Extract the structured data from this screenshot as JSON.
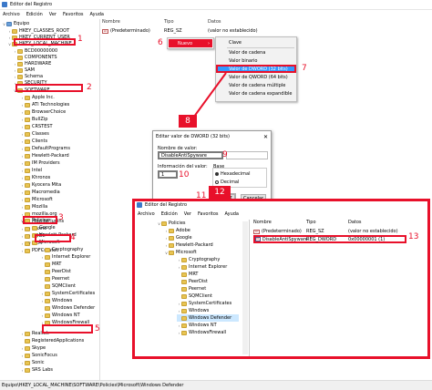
{
  "window": {
    "title": "Editor del Registro"
  },
  "menu": [
    "Archivo",
    "Edición",
    "Ver",
    "Favoritos",
    "Ayuda"
  ],
  "tree": {
    "root": "Equipo",
    "items": [
      "HKEY_CLASSES_ROOT",
      "HKEY_CURRENT_USER",
      "HKEY_LOCAL_MACHINE",
      "BCD00000000",
      "COMPONENTS",
      "HARDWARE",
      "SAM",
      "Schema",
      "SECURITY",
      "SOFTWARE",
      "Apple Inc.",
      "ATI Technologies",
      "BrowserChoice",
      "BullZip",
      "CRSTEST",
      "Classes",
      "Clients",
      "DefaultPrograms",
      "Hewlett-Packard",
      "IM Providers",
      "Intel",
      "Khronos",
      "Kyocera Mita",
      "Macromedia",
      "Microsoft",
      "Mozilla",
      "mozilla.org",
      "MozillaPlugins",
      "Oaxne",
      "ODBC",
      "OEM",
      "PDFCreator",
      "Policies",
      "Google",
      "Hewlett-Packard",
      "Microsoft",
      "Cryptography",
      "Internet Explorer",
      "MRT",
      "PeerDist",
      "Peernet",
      "SQMClient",
      "SystemCertificates",
      "Windows",
      "Windows Defender",
      "Windows NT",
      "WindowsFirewall",
      "Realtek",
      "RegisteredApplications",
      "Skype",
      "SonicFocus",
      "Sonic",
      "SRS Labs"
    ]
  },
  "columns": {
    "name": "Nombre",
    "type": "Tipo",
    "data": "Datos"
  },
  "values": [
    {
      "name": "(Predeterminado)",
      "type": "REG_SZ",
      "data": "(valor no establecido)"
    }
  ],
  "context_menu": {
    "item": "Nuevo"
  },
  "submenu": [
    "Clave",
    "Valor de cadena",
    "Valor binario",
    "Valor de DWORD (32 bits)",
    "Valor de QWORD (64 bits)",
    "Valor de cadena múltiple",
    "Valor de cadena expandible"
  ],
  "dialog": {
    "title": "Editar valor de DWORD (32 bits)",
    "name_label": "Nombre de valor:",
    "name_value": "DisableAntiSpyware",
    "data_label": "Información del valor:",
    "data_value": "1",
    "base_label": "Base",
    "hex": "Hexadecimal",
    "dec": "Decimal",
    "ok": "Aceptar",
    "cancel": "Cancelar"
  },
  "inset": {
    "title": "Editor del Registro",
    "menu": [
      "Archivo",
      "Edición",
      "Ver",
      "Favoritos",
      "Ayuda"
    ],
    "tree": [
      "Policies",
      "Adobe",
      "Google",
      "Hewlett-Packard",
      "Microsoft",
      "Cryptography",
      "Internet Explorer",
      "MRT",
      "PeerDist",
      "Peernet",
      "SQMClient",
      "SystemCertificates",
      "Windows",
      "Windows Defender",
      "Windows NT",
      "WindowsFirewall"
    ],
    "columns": {
      "name": "Nombre",
      "type": "Tipo",
      "data": "Datos"
    },
    "rows": [
      {
        "name": "(Predeterminado)",
        "type": "REG_SZ",
        "data": "(valor no establecido)"
      },
      {
        "name": "DisableAntiSpyware",
        "type": "REG_DWORD",
        "data": "0x00000001 (1)"
      }
    ]
  },
  "steps": [
    "1",
    "2",
    "3",
    "4",
    "5",
    "6",
    "7",
    "8",
    "9",
    "10",
    "11",
    "12",
    "13"
  ],
  "status": "Equipo\\HKEY_LOCAL_MACHINE\\SOFTWARE\\Policies\\Microsoft\\Windows Defender",
  "colors": {
    "highlight": "#e8102a",
    "selection": "#3399ff"
  }
}
